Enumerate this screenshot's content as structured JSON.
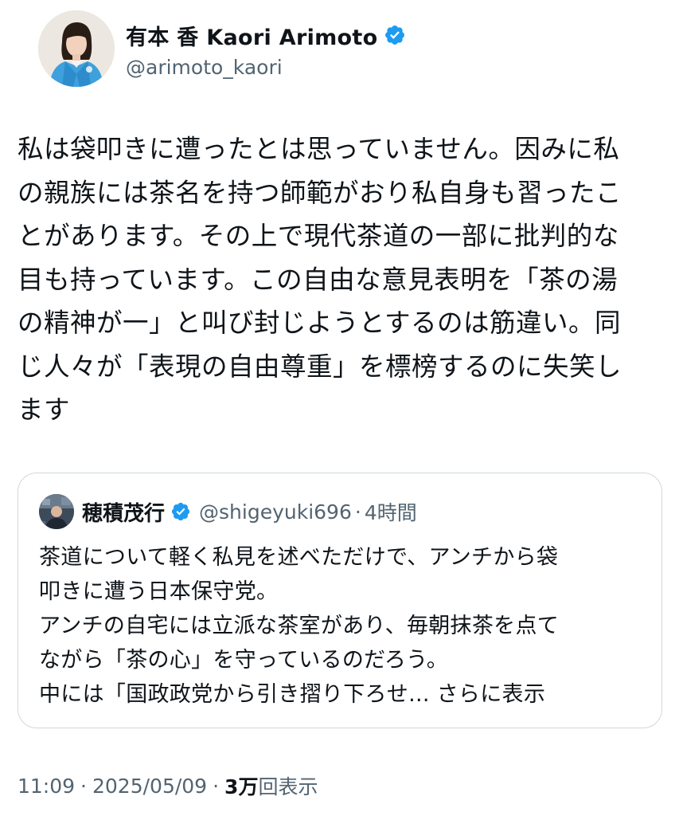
{
  "author": {
    "display_name": "有本 香 Kaori Arimoto",
    "handle": "@arimoto_kaori",
    "avatar_icon": "profile-photo-avatar",
    "verified_icon": "verified-badge-icon",
    "verified_color": "#1d9bf0"
  },
  "tweet": {
    "lines": [
      "私は袋叩きに遭ったとは思っていません。因みに私",
      "の親族には茶名を持つ師範がおり私自身も習ったこ",
      "とがあります。その上で現代茶道の一部に批判的な",
      "目も持っています。この自由な意見表明を「茶の湯",
      "の精神が一」と叫び封じようとするのは筋違い。同",
      "じ人々が「表現の自由尊重」を標榜するのに失笑し",
      "ます"
    ]
  },
  "quote": {
    "display_name": "穂積茂行",
    "handle": "@shigeyuki696",
    "separator": "·",
    "time": "4時間",
    "lines": [
      "茶道について軽く私見を述べただけで、アンチから袋",
      "叩きに遭う日本保守党。",
      "アンチの自宅には立派な茶室があり、毎朝抹茶を点て",
      "ながら「茶の心」を守っているのだろう。",
      "中には「国政政党から引き摺り下ろせ..."
    ],
    "show_more": " さらに表示"
  },
  "meta": {
    "time": "11:09",
    "separator": "·",
    "date": "2025/05/09",
    "views_count": "3万",
    "views_label": "回表示"
  },
  "colors": {
    "text": "#0f1419",
    "secondary": "#536471",
    "border": "#cfd9de",
    "accent": "#1d9bf0"
  }
}
